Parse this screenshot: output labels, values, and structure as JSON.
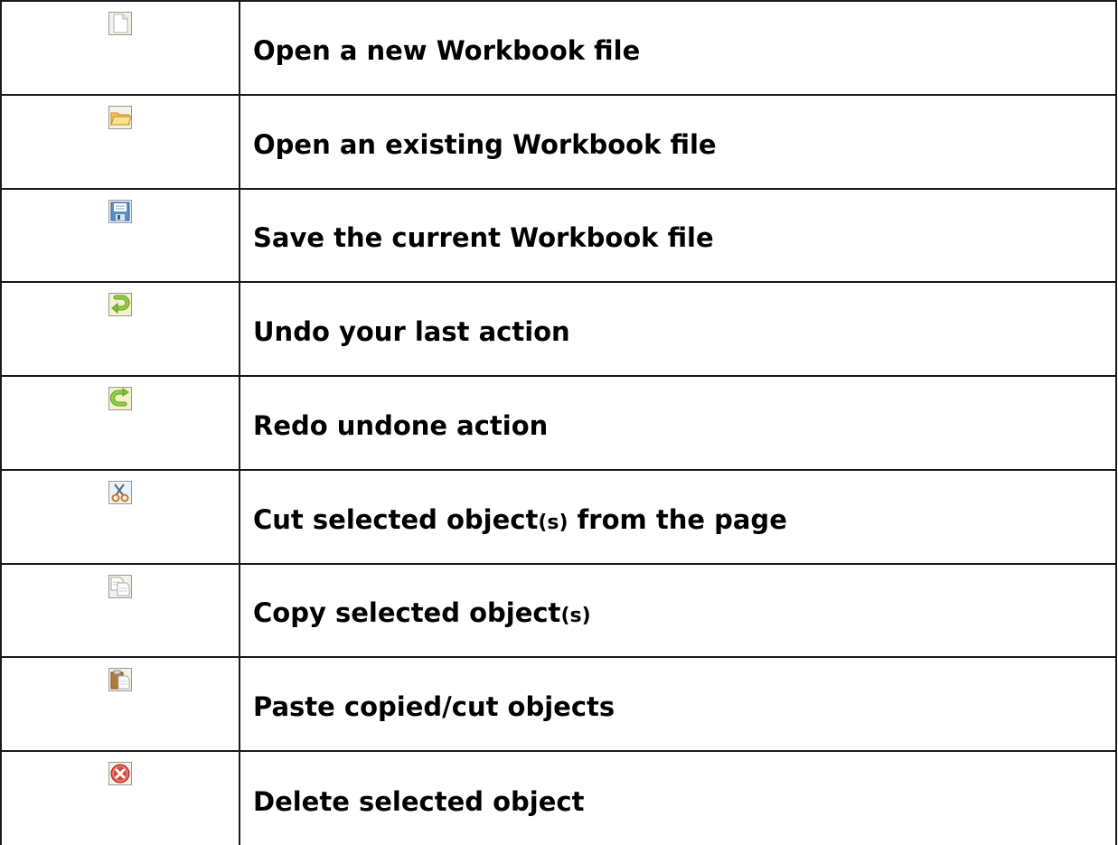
{
  "rows": [
    {
      "icon": "new-document-icon",
      "text": "Open a new Workbook file"
    },
    {
      "icon": "open-folder-icon",
      "text": "Open an existing Workbook file"
    },
    {
      "icon": "save-floppy-icon",
      "text": "Save the current Workbook file"
    },
    {
      "icon": "undo-arrow-icon",
      "text": "Undo your last action"
    },
    {
      "icon": "redo-arrow-icon",
      "text": "Redo undone action"
    },
    {
      "icon": "scissors-icon",
      "text_before": "Cut selected object",
      "text_small": "(s)",
      "text_after": " from the page"
    },
    {
      "icon": "copy-documents-icon",
      "text_before": "Copy selected object",
      "text_small": "(s)",
      "text_after": ""
    },
    {
      "icon": "clipboard-paste-icon",
      "text": "Paste copied/cut objects"
    },
    {
      "icon": "delete-x-icon",
      "text": "Delete selected object"
    }
  ],
  "colors": {
    "border": "#1a1a1a",
    "icon_frame": "#8a8a8a",
    "folder": "#f3c15a",
    "arrow_green": "#7fbf3a",
    "delete_red": "#e0463c",
    "floppy_blue": "#5a8fc8"
  }
}
